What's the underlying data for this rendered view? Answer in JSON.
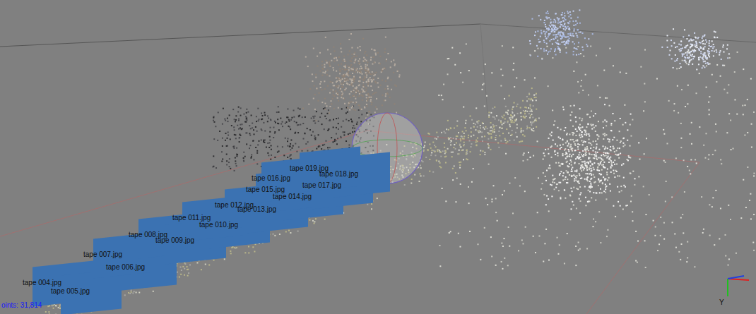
{
  "viewport": {
    "cameras": [
      {
        "label": "tape 004.jpg"
      },
      {
        "label": "tape 005.jpg"
      },
      {
        "label": "tape 006.jpg"
      },
      {
        "label": "tape 007.jpg"
      },
      {
        "label": "tape 008.jpg"
      },
      {
        "label": "tape 009.jpg"
      },
      {
        "label": "tape 010.jpg"
      },
      {
        "label": "tape 011.jpg"
      },
      {
        "label": "tape 012.jpg"
      },
      {
        "label": "tape 013.jpg"
      },
      {
        "label": "tape 014.jpg"
      },
      {
        "label": "tape 015.jpg"
      },
      {
        "label": "tape 016.jpg"
      },
      {
        "label": "tape 017.jpg"
      },
      {
        "label": "tape 018.jpg"
      },
      {
        "label": "tape 019.jpg"
      }
    ],
    "axis_label": "Y"
  },
  "status_bar": {
    "text": "oints: 31,814"
  }
}
